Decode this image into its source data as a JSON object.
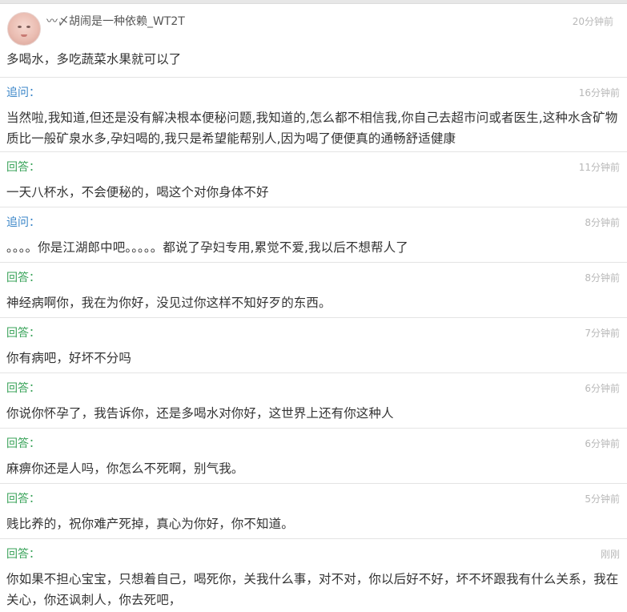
{
  "first_post": {
    "username": "〰〆胡闹是一种依赖_WT2T",
    "time": "20分钟前",
    "text": "多喝水，多吃蔬菜水果就可以了"
  },
  "entries": [
    {
      "kind": "ask",
      "label": "追问：",
      "time": "16分钟前",
      "text": "当然啦,我知道,但还是没有解决根本便秘问题,我知道的,怎么都不相信我,你自己去超市问或者医生,这种水含矿物质比一般矿泉水多,孕妇喝的,我只是希望能帮别人,因为喝了便便真的通畅舒适健康"
    },
    {
      "kind": "answer",
      "label": "回答：",
      "time": "11分钟前",
      "text": "一天八杯水，不会便秘的，喝这个对你身体不好"
    },
    {
      "kind": "ask",
      "label": "追问：",
      "time": "8分钟前",
      "text": "。。。。你是江湖郎中吧。。。。。都说了孕妇专用,累觉不爱,我以后不想帮人了"
    },
    {
      "kind": "answer",
      "label": "回答：",
      "time": "8分钟前",
      "text": "神经病啊你，我在为你好，没见过你这样不知好歹的东西。"
    },
    {
      "kind": "answer",
      "label": "回答：",
      "time": "7分钟前",
      "text": "你有病吧，好坏不分吗"
    },
    {
      "kind": "answer",
      "label": "回答：",
      "time": "6分钟前",
      "text": "你说你怀孕了，我告诉你，还是多喝水对你好，这世界上还有你这种人"
    },
    {
      "kind": "answer",
      "label": "回答：",
      "time": "6分钟前",
      "text": "麻痹你还是人吗，你怎么不死啊，别气我。"
    },
    {
      "kind": "answer",
      "label": "回答：",
      "time": "5分钟前",
      "text": "贱比养的，祝你难产死掉，真心为你好，你不知道。"
    },
    {
      "kind": "answer",
      "label": "回答：",
      "time": "刚刚",
      "text": "你如果不担心宝宝，只想着自己，喝死你，关我什么事，对不对，你以后好不好，坏不坏跟我有什么关系，我在关心，你还讽刺人，你去死吧，"
    }
  ],
  "colors": {
    "ask_label": "#3b86c8",
    "answer_label": "#3aa35a",
    "time": "#b8b8b8",
    "body": "#333333",
    "divider": "#e4e4e4"
  }
}
